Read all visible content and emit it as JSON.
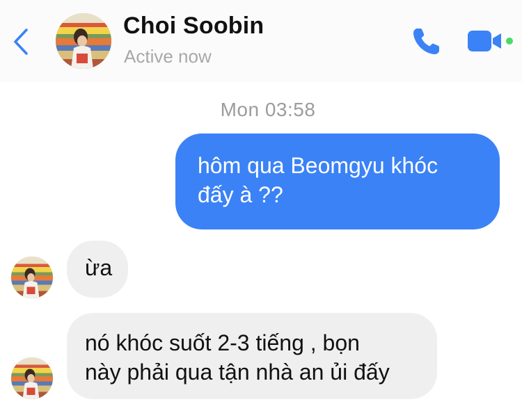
{
  "header": {
    "contact_name": "Choi Soobin",
    "status": "Active now",
    "back_icon": "chevron-left-icon",
    "call_icon": "phone-icon",
    "video_icon": "video-camera-icon",
    "active_dot_color": "#4cd964",
    "accent_color": "#3b82f6"
  },
  "conversation": {
    "timestamp": "Mon 03:58",
    "messages": [
      {
        "direction": "outgoing",
        "lines": [
          "hôm qua Beomgyu khóc",
          "đấy à ??"
        ]
      },
      {
        "direction": "incoming",
        "lines": [
          "ừa"
        ]
      },
      {
        "direction": "incoming",
        "lines": [
          "nó khóc suốt 2-3 tiếng , bọn",
          "này phải qua tận nhà an ủi đấy"
        ]
      }
    ]
  }
}
